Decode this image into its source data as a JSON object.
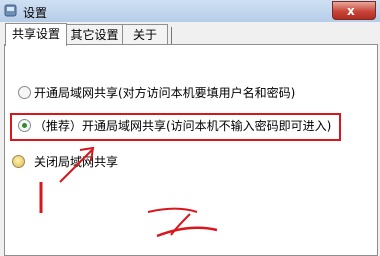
{
  "window": {
    "title": "设置",
    "close_label": "x"
  },
  "tabs": [
    {
      "label": "共享设置",
      "active": true
    },
    {
      "label": "其它设置",
      "active": false
    },
    {
      "label": "关于",
      "active": false
    }
  ],
  "options": [
    {
      "label": "开通局域网共享(对方访问本机要填用户名和密码)",
      "checked": false
    },
    {
      "label": "（推荐）开通局域网共享(访问本机不输入密码即可进入)",
      "checked": true
    },
    {
      "label": "关闭局域网共享",
      "checked": false
    }
  ],
  "colors": {
    "annotation": "#d8161c",
    "radio_checked": "#2d8c2d"
  }
}
